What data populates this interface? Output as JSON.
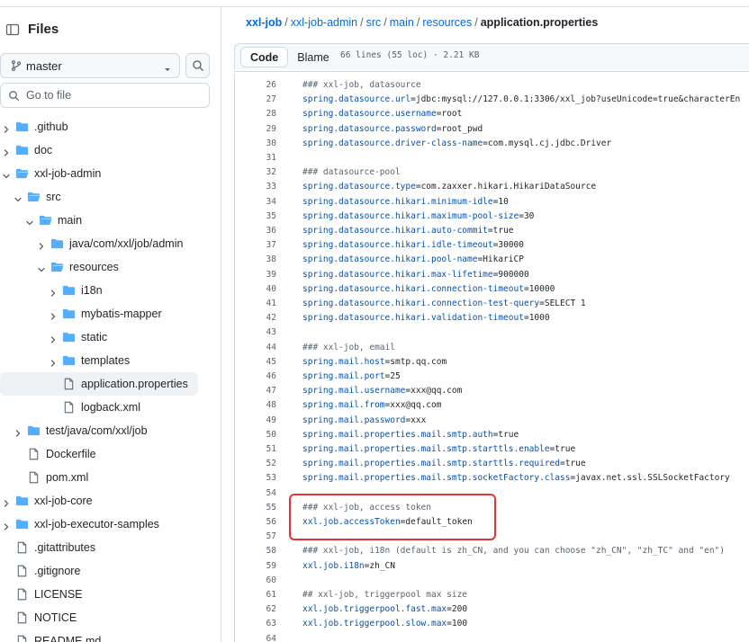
{
  "sidebar": {
    "title": "Files",
    "branch": "master",
    "goto_placeholder": "Go to file",
    "tree": [
      {
        "label": ".github",
        "type": "folder",
        "depth": 0,
        "expanded": false
      },
      {
        "label": "doc",
        "type": "folder",
        "depth": 0,
        "expanded": false
      },
      {
        "label": "xxl-job-admin",
        "type": "folder",
        "depth": 0,
        "expanded": true
      },
      {
        "label": "src",
        "type": "folder",
        "depth": 1,
        "expanded": true
      },
      {
        "label": "main",
        "type": "folder",
        "depth": 2,
        "expanded": true
      },
      {
        "label": "java/com/xxl/job/admin",
        "type": "folder",
        "depth": 3,
        "expanded": false
      },
      {
        "label": "resources",
        "type": "folder",
        "depth": 3,
        "expanded": true
      },
      {
        "label": "i18n",
        "type": "folder",
        "depth": 4,
        "expanded": false
      },
      {
        "label": "mybatis-mapper",
        "type": "folder",
        "depth": 4,
        "expanded": false
      },
      {
        "label": "static",
        "type": "folder",
        "depth": 4,
        "expanded": false
      },
      {
        "label": "templates",
        "type": "folder",
        "depth": 4,
        "expanded": false
      },
      {
        "label": "application.properties",
        "type": "file",
        "depth": 4,
        "selected": true
      },
      {
        "label": "logback.xml",
        "type": "file",
        "depth": 4
      },
      {
        "label": "test/java/com/xxl/job",
        "type": "folder",
        "depth": 1,
        "expanded": false
      },
      {
        "label": "Dockerfile",
        "type": "file",
        "depth": 1
      },
      {
        "label": "pom.xml",
        "type": "file",
        "depth": 1
      },
      {
        "label": "xxl-job-core",
        "type": "folder",
        "depth": 0,
        "expanded": false
      },
      {
        "label": "xxl-job-executor-samples",
        "type": "folder",
        "depth": 0,
        "expanded": false
      },
      {
        "label": ".gitattributes",
        "type": "file",
        "depth": 0
      },
      {
        "label": ".gitignore",
        "type": "file",
        "depth": 0
      },
      {
        "label": "LICENSE",
        "type": "file",
        "depth": 0
      },
      {
        "label": "NOTICE",
        "type": "file",
        "depth": 0
      },
      {
        "label": "README.md",
        "type": "file",
        "depth": 0
      }
    ]
  },
  "breadcrumb": {
    "parts": [
      "xxl-job",
      "xxl-job-admin",
      "src",
      "main",
      "resources"
    ],
    "current": "application.properties"
  },
  "toolbar": {
    "code_label": "Code",
    "blame_label": "Blame",
    "file_info": "66 lines (55 loc) · 2.21 KB"
  },
  "code_lines": [
    {
      "n": "26",
      "text": "### xxl-job, datasource",
      "kind": "comment"
    },
    {
      "n": "27",
      "key": "spring.datasource.url",
      "value": "jdbc:mysql://127.0.0.1:3306/xxl_job?useUnicode=true&characterEn"
    },
    {
      "n": "28",
      "key": "spring.datasource.username",
      "value": "root"
    },
    {
      "n": "29",
      "key": "spring.datasource.password",
      "value": "root_pwd"
    },
    {
      "n": "30",
      "key": "spring.datasource.driver-class-name",
      "value": "com.mysql.cj.jdbc.Driver"
    },
    {
      "n": "31",
      "text": "",
      "kind": "blank"
    },
    {
      "n": "32",
      "text": "### datasource-pool",
      "kind": "comment"
    },
    {
      "n": "33",
      "key": "spring.datasource.type",
      "value": "com.zaxxer.hikari.HikariDataSource"
    },
    {
      "n": "34",
      "key": "spring.datasource.hikari.minimum-idle",
      "value": "10"
    },
    {
      "n": "35",
      "key": "spring.datasource.hikari.maximum-pool-size",
      "value": "30"
    },
    {
      "n": "36",
      "key": "spring.datasource.hikari.auto-commit",
      "value": "true"
    },
    {
      "n": "37",
      "key": "spring.datasource.hikari.idle-timeout",
      "value": "30000"
    },
    {
      "n": "38",
      "key": "spring.datasource.hikari.pool-name",
      "value": "HikariCP"
    },
    {
      "n": "39",
      "key": "spring.datasource.hikari.max-lifetime",
      "value": "900000"
    },
    {
      "n": "40",
      "key": "spring.datasource.hikari.connection-timeout",
      "value": "10000"
    },
    {
      "n": "41",
      "key": "spring.datasource.hikari.connection-test-query",
      "value": "SELECT 1"
    },
    {
      "n": "42",
      "key": "spring.datasource.hikari.validation-timeout",
      "value": "1000"
    },
    {
      "n": "43",
      "text": "",
      "kind": "blank"
    },
    {
      "n": "44",
      "text": "### xxl-job, email",
      "kind": "comment"
    },
    {
      "n": "45",
      "key": "spring.mail.host",
      "value": "smtp.qq.com"
    },
    {
      "n": "46",
      "key": "spring.mail.port",
      "value": "25"
    },
    {
      "n": "47",
      "key": "spring.mail.username",
      "value": "xxx@qq.com"
    },
    {
      "n": "48",
      "key": "spring.mail.from",
      "value": "xxx@qq.com"
    },
    {
      "n": "49",
      "key": "spring.mail.password",
      "value": "xxx"
    },
    {
      "n": "50",
      "key": "spring.mail.properties.mail.smtp.auth",
      "value": "true"
    },
    {
      "n": "51",
      "key": "spring.mail.properties.mail.smtp.starttls.enable",
      "value": "true"
    },
    {
      "n": "52",
      "key": "spring.mail.properties.mail.smtp.starttls.required",
      "value": "true"
    },
    {
      "n": "53",
      "key": "spring.mail.properties.mail.smtp.socketFactory.class",
      "value": "javax.net.ssl.SSLSocketFactory"
    },
    {
      "n": "54",
      "text": "",
      "kind": "blank"
    },
    {
      "n": "55",
      "text": "### xxl-job, access token",
      "kind": "comment"
    },
    {
      "n": "56",
      "key": "xxl.job.accessToken",
      "value": "default_token"
    },
    {
      "n": "57",
      "text": "",
      "kind": "blank"
    },
    {
      "n": "58",
      "text": "### xxl-job, i18n (default is zh_CN, and you can choose \"zh_CN\", \"zh_TC\" and \"en\")",
      "kind": "comment"
    },
    {
      "n": "59",
      "key": "xxl.job.i18n",
      "value": "zh_CN"
    },
    {
      "n": "60",
      "text": "",
      "kind": "blank"
    },
    {
      "n": "61",
      "text": "## xxl-job, triggerpool max size",
      "kind": "comment"
    },
    {
      "n": "62",
      "key": "xxl.job.triggerpool.fast.max",
      "value": "200"
    },
    {
      "n": "63",
      "key": "xxl.job.triggerpool.slow.max",
      "value": "100"
    },
    {
      "n": "64",
      "text": "",
      "kind": "blank"
    }
  ],
  "colors": {
    "link": "#0969da",
    "key": "#0550ae",
    "folder": "#54aeff",
    "highlight_border": "#e5333a"
  },
  "icons": [
    "sidebar-panel-icon",
    "git-branch-icon",
    "chevron-down-icon",
    "search-icon",
    "chevron-right-icon",
    "folder-icon",
    "file-icon"
  ]
}
